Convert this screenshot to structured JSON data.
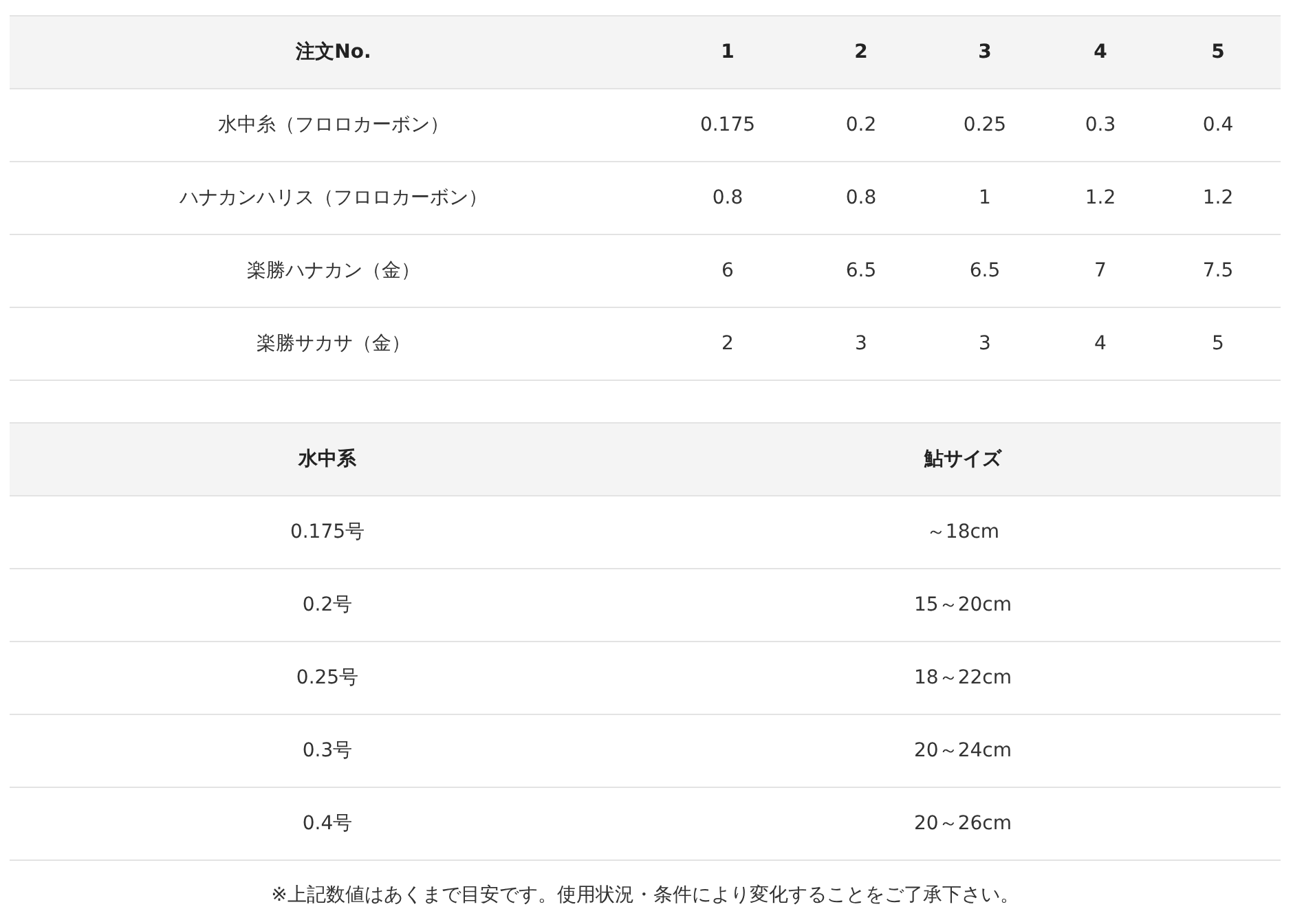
{
  "tables": [
    {
      "columns": [
        "注文No.",
        "1",
        "2",
        "3",
        "4",
        "5"
      ],
      "rows": [
        [
          "水中糸（フロロカーボン）",
          "0.175",
          "0.2",
          "0.25",
          "0.3",
          "0.4"
        ],
        [
          "ハナカンハリス（フロロカーボン）",
          "0.8",
          "0.8",
          "1",
          "1.2",
          "1.2"
        ],
        [
          "楽勝ハナカン（金）",
          "6",
          "6.5",
          "6.5",
          "7",
          "7.5"
        ],
        [
          "楽勝サカサ（金）",
          "2",
          "3",
          "3",
          "4",
          "5"
        ]
      ]
    },
    {
      "columns": [
        "水中系",
        "鮎サイズ"
      ],
      "rows": [
        [
          "0.175号",
          "～18cm"
        ],
        [
          "0.2号",
          "15～20cm"
        ],
        [
          "0.25号",
          "18～22cm"
        ],
        [
          "0.3号",
          "20～24cm"
        ],
        [
          "0.4号",
          "20～26cm"
        ]
      ]
    }
  ],
  "note": "※上記数値はあくまで目安です。使用状況・条件により変化することをご了承下さい。"
}
